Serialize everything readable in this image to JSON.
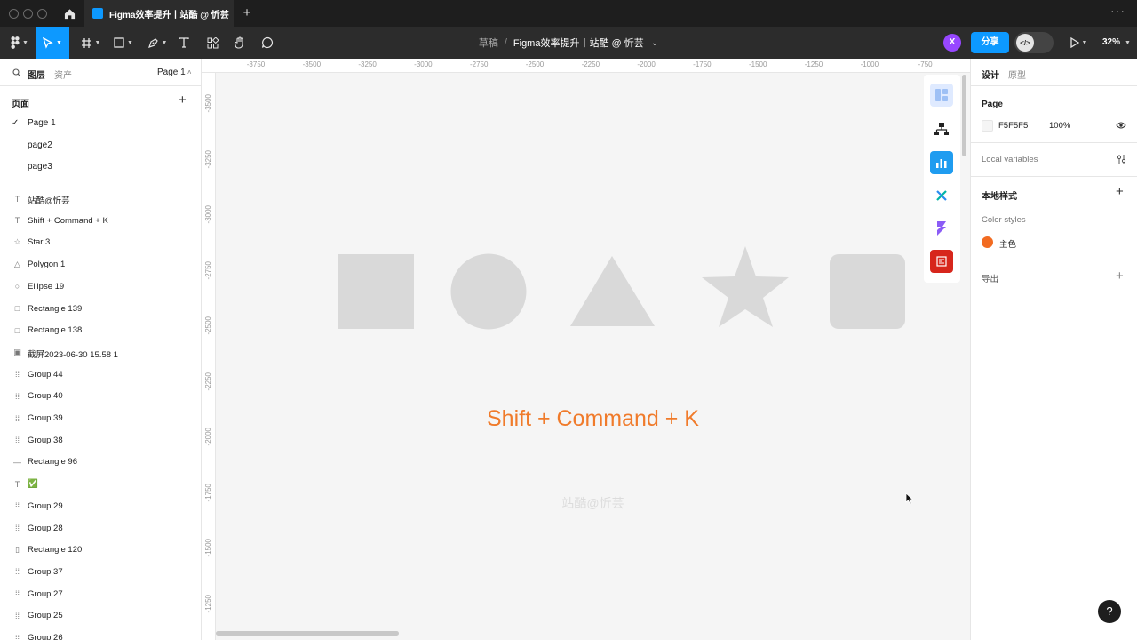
{
  "titlebar": {
    "tab_title": "Figma效率提升丨站酷 @ 忻芸",
    "tab_close": "×",
    "new_tab": "+",
    "more_menu": "···"
  },
  "toolbar": {
    "breadcrumb_draft": "草稿",
    "breadcrumb_sep": "/",
    "file_name": "Figma效率提升丨站酷 @ 忻芸",
    "file_chevron": "⌄",
    "avatar_initial": "X",
    "share_label": "分享",
    "dev_mode_icon": "</>",
    "zoom": "32%"
  },
  "left_panel": {
    "tab_layers": "图层",
    "tab_assets": "资产",
    "current_page": "Page 1",
    "pages_heading": "页面",
    "add_page": "+",
    "check": "✓",
    "pages": [
      "Page 1",
      "page2",
      "page3"
    ],
    "layers": [
      {
        "icon": "text-icon",
        "glyph": "T",
        "label": "站酷@忻芸"
      },
      {
        "icon": "text-icon",
        "glyph": "T",
        "label": "Shift + Command + K"
      },
      {
        "icon": "star-icon",
        "glyph": "☆",
        "label": "Star 3"
      },
      {
        "icon": "polygon-icon",
        "glyph": "△",
        "label": "Polygon 1"
      },
      {
        "icon": "ellipse-icon",
        "glyph": "○",
        "label": "Ellipse 19"
      },
      {
        "icon": "rectangle-icon",
        "glyph": "□",
        "label": "Rectangle 139"
      },
      {
        "icon": "rectangle-icon",
        "glyph": "□",
        "label": "Rectangle 138"
      },
      {
        "icon": "image-icon",
        "glyph": "▣",
        "label": "截屏2023-06-30 15.58 1"
      },
      {
        "icon": "group-icon",
        "glyph": "⁞⁞",
        "label": "Group 44"
      },
      {
        "icon": "group-icon",
        "glyph": "⁞⁞",
        "label": "Group 40"
      },
      {
        "icon": "group-icon",
        "glyph": "⁞⁞",
        "label": "Group 39"
      },
      {
        "icon": "group-icon",
        "glyph": "⁞⁞",
        "label": "Group 38"
      },
      {
        "icon": "line-icon",
        "glyph": "—",
        "label": "Rectangle 96"
      },
      {
        "icon": "text-icon",
        "glyph": "T",
        "label": "✅"
      },
      {
        "icon": "group-icon",
        "glyph": "⁞⁞",
        "label": "Group 29"
      },
      {
        "icon": "group-icon",
        "glyph": "⁞⁞",
        "label": "Group 28"
      },
      {
        "icon": "thin-rectangle-icon",
        "glyph": "▯",
        "label": "Rectangle 120"
      },
      {
        "icon": "group-icon",
        "glyph": "⁞⁞",
        "label": "Group 37"
      },
      {
        "icon": "group-icon",
        "glyph": "⁞⁞",
        "label": "Group 27"
      },
      {
        "icon": "group-icon",
        "glyph": "⁞⁞",
        "label": "Group 25"
      },
      {
        "icon": "group-icon",
        "glyph": "⁞⁞",
        "label": "Group 26"
      }
    ]
  },
  "rulers": {
    "top": [
      "-3750",
      "-3500",
      "-3250",
      "-3000",
      "-2750",
      "-2500",
      "-2250",
      "-2000",
      "-1750",
      "-1500",
      "-1250",
      "-1000",
      "-750"
    ],
    "left": [
      "-3500",
      "-3250",
      "-3000",
      "-2750",
      "-2500",
      "-2250",
      "-2000",
      "-1750",
      "-1500",
      "-1250"
    ]
  },
  "canvas": {
    "shortcut_text": "Shift + Command + K",
    "watermark": "站酷@忻芸",
    "shape_fill": "#d9d9d9",
    "accent_text_color": "#f07b2b"
  },
  "right_panel": {
    "tab_design": "设计",
    "tab_prototype": "原型",
    "page_heading": "Page",
    "page_color": "F5F5F5",
    "page_opacity": "100%",
    "local_variables": "Local variables",
    "local_styles": "本地样式",
    "add_style": "+",
    "color_styles": "Color styles",
    "main_color_name": "主色",
    "main_color": "#f26b21",
    "export": "导出",
    "add_export": "+"
  },
  "help": "?"
}
